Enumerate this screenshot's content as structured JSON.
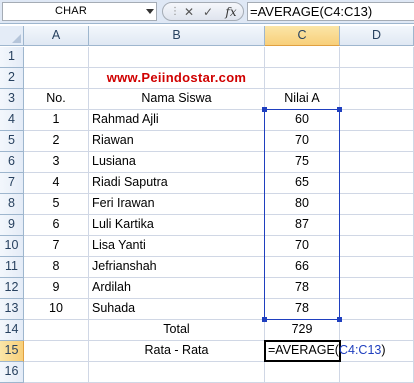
{
  "name_box": {
    "value": "CHAR"
  },
  "formula_bar": {
    "cancel_glyph": "✕",
    "enter_glyph": "✓",
    "fx_label": "fx",
    "formula": "=AVERAGE(C4:C13)"
  },
  "columns": [
    "A",
    "B",
    "C",
    "D"
  ],
  "rows": [
    "1",
    "2",
    "3",
    "4",
    "5",
    "6",
    "7",
    "8",
    "9",
    "10",
    "11",
    "12",
    "13",
    "14",
    "15",
    "16"
  ],
  "sheet": {
    "website": "www.Peiindostar.com",
    "headers": {
      "no": "No.",
      "name": "Nama Siswa",
      "score": "Nilai A"
    },
    "students": [
      {
        "no": "1",
        "name": "Rahmad Ajli",
        "score": "60"
      },
      {
        "no": "2",
        "name": "Riawan",
        "score": "70"
      },
      {
        "no": "3",
        "name": "Lusiana",
        "score": "75"
      },
      {
        "no": "4",
        "name": "Riadi Saputra",
        "score": "65"
      },
      {
        "no": "5",
        "name": "Feri Irawan",
        "score": "80"
      },
      {
        "no": "6",
        "name": "Luli Kartika",
        "score": "87"
      },
      {
        "no": "7",
        "name": "Lisa Yanti",
        "score": "70"
      },
      {
        "no": "8",
        "name": "Jefrianshah",
        "score": "66"
      },
      {
        "no": "9",
        "name": "Ardilah",
        "score": "78"
      },
      {
        "no": "10",
        "name": "Suhada",
        "score": "78"
      }
    ],
    "total_label": "Total",
    "total_value": "729",
    "average_label": "Rata - Rata",
    "active_cell": {
      "prefix": "=AVERAGE(",
      "ref": "C4:C13",
      "suffix": ")"
    }
  },
  "colors": {
    "website": "#d00000",
    "range_border": "#1f3fbf",
    "selected_header": "#f8cf7a"
  }
}
